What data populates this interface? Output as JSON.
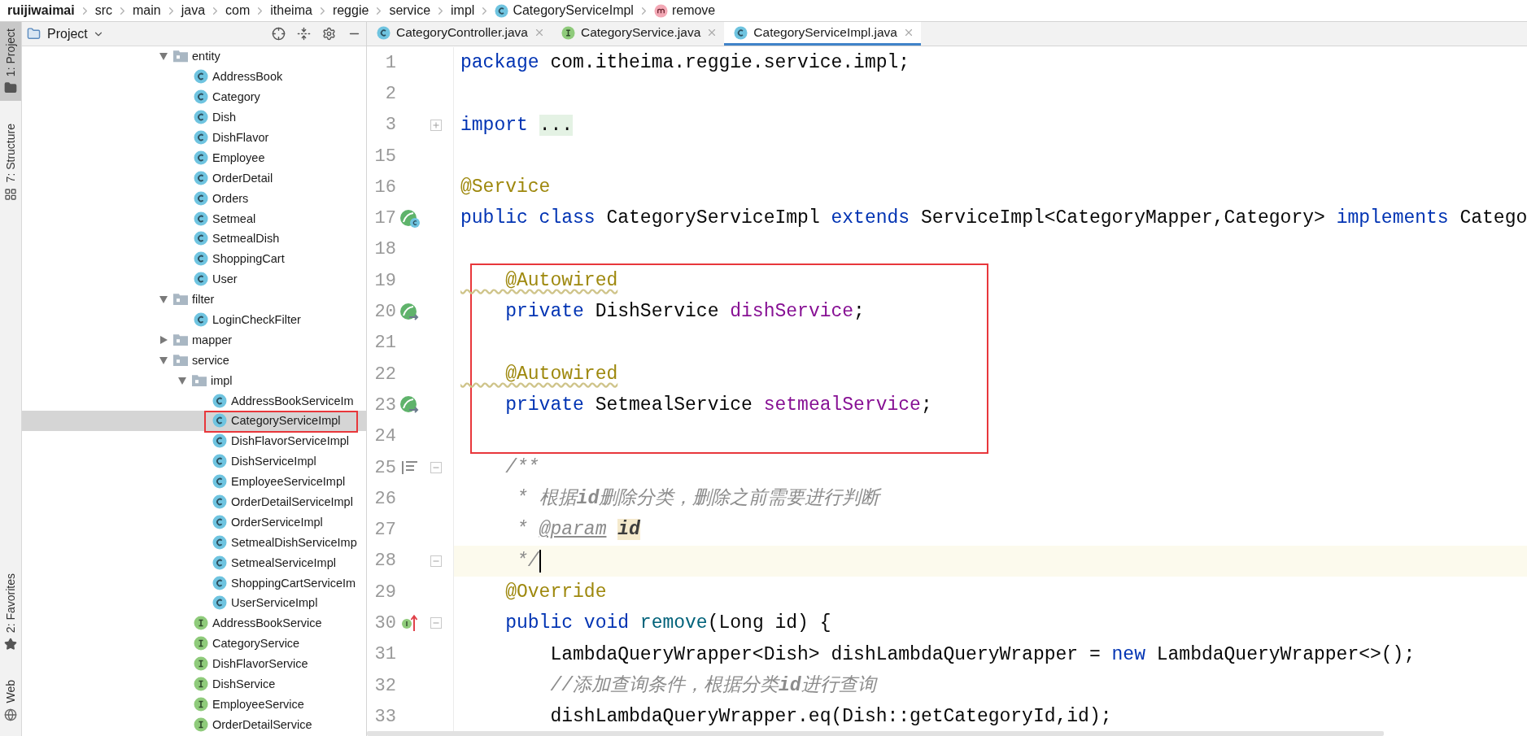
{
  "breadcrumbs": [
    {
      "label": "ruijiwaimai",
      "kind": "project"
    },
    {
      "label": "src",
      "kind": "folder"
    },
    {
      "label": "main",
      "kind": "folder"
    },
    {
      "label": "java",
      "kind": "folder"
    },
    {
      "label": "com",
      "kind": "folder"
    },
    {
      "label": "itheima",
      "kind": "folder"
    },
    {
      "label": "reggie",
      "kind": "folder"
    },
    {
      "label": "service",
      "kind": "folder"
    },
    {
      "label": "impl",
      "kind": "folder"
    },
    {
      "label": "CategoryServiceImpl",
      "kind": "class"
    },
    {
      "label": "remove",
      "kind": "method"
    }
  ],
  "tool_strip": {
    "top": [
      {
        "label": "1: Project",
        "selected": true
      },
      {
        "label": "7: Structure",
        "selected": false
      }
    ],
    "bottom": [
      {
        "label": "2: Favorites",
        "selected": false
      },
      {
        "label": "Web",
        "selected": false
      }
    ]
  },
  "project_panel": {
    "title": "Project",
    "tree": [
      {
        "label": "entity",
        "kind": "folder",
        "expanded": true,
        "selected": false,
        "children": [
          {
            "label": "AddressBook",
            "kind": "class",
            "selected": false
          },
          {
            "label": "Category",
            "kind": "class",
            "selected": false
          },
          {
            "label": "Dish",
            "kind": "class",
            "selected": false
          },
          {
            "label": "DishFlavor",
            "kind": "class",
            "selected": false
          },
          {
            "label": "Employee",
            "kind": "class",
            "selected": false
          },
          {
            "label": "OrderDetail",
            "kind": "class",
            "selected": false
          },
          {
            "label": "Orders",
            "kind": "class",
            "selected": false
          },
          {
            "label": "Setmeal",
            "kind": "class",
            "selected": false
          },
          {
            "label": "SetmealDish",
            "kind": "class",
            "selected": false
          },
          {
            "label": "ShoppingCart",
            "kind": "class",
            "selected": false
          },
          {
            "label": "User",
            "kind": "class",
            "selected": false
          }
        ]
      },
      {
        "label": "filter",
        "kind": "folder",
        "expanded": true,
        "selected": false,
        "children": [
          {
            "label": "LoginCheckFilter",
            "kind": "class",
            "selected": false
          }
        ]
      },
      {
        "label": "mapper",
        "kind": "folder",
        "expanded": false,
        "selected": false
      },
      {
        "label": "service",
        "kind": "folder",
        "expanded": true,
        "selected": false,
        "children": [
          {
            "label": "impl",
            "kind": "folder",
            "expanded": true,
            "selected": false,
            "children": [
              {
                "label": "AddressBookServiceIm",
                "kind": "class",
                "selected": false
              },
              {
                "label": "CategoryServiceImpl",
                "kind": "class",
                "selected": true,
                "boxed": true
              },
              {
                "label": "DishFlavorServiceImpl",
                "kind": "class",
                "selected": false
              },
              {
                "label": "DishServiceImpl",
                "kind": "class",
                "selected": false
              },
              {
                "label": "EmployeeServiceImpl",
                "kind": "class",
                "selected": false
              },
              {
                "label": "OrderDetailServiceImpl",
                "kind": "class",
                "selected": false
              },
              {
                "label": "OrderServiceImpl",
                "kind": "class",
                "selected": false
              },
              {
                "label": "SetmealDishServiceImp",
                "kind": "class",
                "selected": false
              },
              {
                "label": "SetmealServiceImpl",
                "kind": "class",
                "selected": false
              },
              {
                "label": "ShoppingCartServiceIm",
                "kind": "class",
                "selected": false
              },
              {
                "label": "UserServiceImpl",
                "kind": "class",
                "selected": false
              }
            ]
          },
          {
            "label": "AddressBookService",
            "kind": "interface",
            "selected": false
          },
          {
            "label": "CategoryService",
            "kind": "interface",
            "selected": false
          },
          {
            "label": "DishFlavorService",
            "kind": "interface",
            "selected": false
          },
          {
            "label": "DishService",
            "kind": "interface",
            "selected": false
          },
          {
            "label": "EmployeeService",
            "kind": "interface",
            "selected": false
          },
          {
            "label": "OrderDetailService",
            "kind": "interface",
            "selected": false
          }
        ]
      }
    ]
  },
  "tabs": [
    {
      "label": "CategoryController.java",
      "kind": "class",
      "selected": false
    },
    {
      "label": "CategoryService.java",
      "kind": "interface",
      "selected": false
    },
    {
      "label": "CategoryServiceImpl.java",
      "kind": "class",
      "selected": true
    }
  ],
  "editor": {
    "blocks": [
      {
        "boxed": false,
        "lines": [
          {
            "number": "1",
            "tokens": [
              {
                "kind": "keyword",
                "text": "package"
              },
              {
                "kind": "plain",
                "text": " com.itheima.reggie.service.impl;"
              }
            ]
          },
          {
            "number": "2"
          },
          {
            "number": "3",
            "fold_toggle": {
              "expanded": false
            },
            "tokens": [
              {
                "kind": "keyword",
                "text": "import "
              },
              {
                "kind": "folded",
                "text": "..."
              }
            ]
          },
          {
            "number": "15"
          },
          {
            "number": "16",
            "tokens": [
              {
                "kind": "annotation",
                "text": "@Service"
              }
            ]
          },
          {
            "number": "17",
            "gutter_icon": {
              "kind": "bean"
            },
            "tokens": [
              {
                "kind": "keyword",
                "text": "public class"
              },
              {
                "kind": "plain",
                "text": " CategoryServiceImpl "
              },
              {
                "kind": "keyword",
                "text": "extends"
              },
              {
                "kind": "plain",
                "text": " ServiceImpl<CategoryMapper,Category> "
              },
              {
                "kind": "keyword",
                "text": "implements"
              },
              {
                "kind": "plain",
                "text": " Catego"
              }
            ]
          },
          {
            "number": "18"
          }
        ]
      },
      {
        "boxed": true,
        "lines": [
          {
            "number": "19",
            "tokens": [
              {
                "kind": "annotation_warning",
                "text": "    @Autowired"
              }
            ]
          },
          {
            "number": "20",
            "gutter_icon": {
              "kind": "autowired"
            },
            "tokens": [
              {
                "kind": "keyword",
                "text": "    private"
              },
              {
                "kind": "plain",
                "text": " DishService "
              },
              {
                "kind": "field",
                "text": "dishService"
              },
              {
                "kind": "plain",
                "text": ";"
              }
            ]
          },
          {
            "number": "21"
          },
          {
            "number": "22",
            "tokens": [
              {
                "kind": "annotation_warning",
                "text": "    @Autowired"
              }
            ]
          },
          {
            "number": "23",
            "gutter_icon": {
              "kind": "autowired"
            },
            "tokens": [
              {
                "kind": "keyword",
                "text": "    private"
              },
              {
                "kind": "plain",
                "text": " SetmealService "
              },
              {
                "kind": "field",
                "text": "setmealService"
              },
              {
                "kind": "plain",
                "text": ";"
              }
            ]
          },
          {
            "number": "24"
          }
        ]
      },
      {
        "boxed": false,
        "lines": [
          {
            "number": "25",
            "gutter_icon": {
              "kind": "doc"
            },
            "fold_toggle": {
              "expanded": true
            },
            "tokens": [
              {
                "kind": "comment",
                "text": "    /**"
              }
            ]
          },
          {
            "number": "26",
            "tokens": [
              {
                "kind": "comment",
                "text": "     * 根据"
              },
              {
                "kind": "comment_bold",
                "text": "id"
              },
              {
                "kind": "comment",
                "text": "删除分类，删除之前需要进行判断"
              }
            ]
          },
          {
            "number": "27",
            "tokens": [
              {
                "kind": "comment",
                "text": "     * "
              },
              {
                "kind": "doc_tag",
                "text": "@param"
              },
              {
                "kind": "doc_param",
                "text": "id"
              }
            ]
          },
          {
            "number": "28",
            "current": true,
            "fold_toggle": {
              "expanded": true
            },
            "tokens": [
              {
                "kind": "comment",
                "text": "     */"
              }
            ]
          },
          {
            "number": "29",
            "tokens": [
              {
                "kind": "annotation",
                "text": "    @Override"
              }
            ]
          },
          {
            "number": "30",
            "gutter_icon": {
              "kind": "implements"
            },
            "fold_toggle": {
              "expanded": true
            },
            "tokens": [
              {
                "kind": "keyword",
                "text": "    public void "
              },
              {
                "kind": "method",
                "text": "remove"
              },
              {
                "kind": "plain",
                "text": "(Long id) {"
              }
            ]
          },
          {
            "number": "31",
            "tokens": [
              {
                "kind": "plain",
                "text": "        LambdaQueryWrapper<Dish> dishLambdaQueryWrapper = "
              },
              {
                "kind": "keyword",
                "text": "new"
              },
              {
                "kind": "plain",
                "text": " LambdaQueryWrapper<>();"
              }
            ]
          },
          {
            "number": "32",
            "tokens": [
              {
                "kind": "comment",
                "text": "        //添加查询条件，根据分类"
              },
              {
                "kind": "comment_bold",
                "text": "id"
              },
              {
                "kind": "comment",
                "text": "进行查询"
              }
            ]
          },
          {
            "number": "33",
            "tokens": [
              {
                "kind": "plain",
                "text": "        dishLambdaQueryWrapper.eq(Dish::getCategoryId,id);"
              }
            ]
          }
        ]
      }
    ]
  }
}
